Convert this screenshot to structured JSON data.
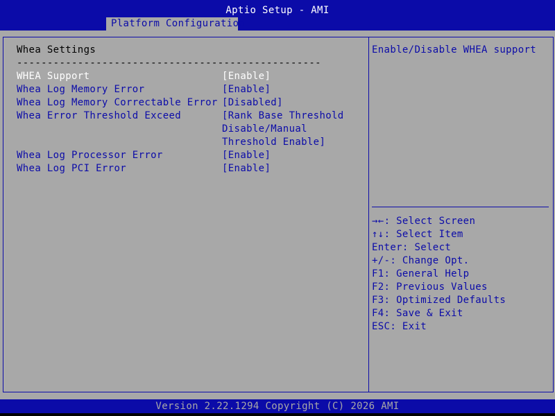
{
  "app": {
    "title": "Aptio Setup - AMI",
    "tab": "Platform Configuration"
  },
  "section": {
    "title": "Whea Settings",
    "separator": "--------------------------------------------------"
  },
  "options": [
    {
      "label": "WHEA Support",
      "value": "[Enable]",
      "selected": true
    },
    {
      "label": "Whea Log Memory Error",
      "value": "[Enable]",
      "selected": false
    },
    {
      "label": "Whea Log Memory Correctable Error",
      "value": "[Disabled]",
      "selected": false
    },
    {
      "label": "Whea Error Threshold Exceed",
      "value_lines": [
        "[Rank Base Threshold",
        "Disable/Manual",
        "Threshold Enable]"
      ],
      "selected": false
    },
    {
      "label": "Whea Log Processor Error",
      "value": "[Enable]",
      "selected": false
    },
    {
      "label": "Whea Log PCI Error",
      "value": "[Enable]",
      "selected": false
    }
  ],
  "help": {
    "description": "Enable/Disable WHEA support",
    "keys": [
      {
        "key": "→←",
        "action": ": Select Screen"
      },
      {
        "key": "↑↓",
        "action": ": Select Item"
      },
      {
        "key": "",
        "action": "Enter: Select"
      },
      {
        "key": "",
        "action": "+/-: Change Opt."
      },
      {
        "key": "",
        "action": "F1: General Help"
      },
      {
        "key": "",
        "action": "F2: Previous Values"
      },
      {
        "key": "",
        "action": "F3: Optimized Defaults"
      },
      {
        "key": "",
        "action": "F4: Save & Exit"
      },
      {
        "key": "",
        "action": "ESC: Exit"
      }
    ]
  },
  "footer": {
    "version": "Version 2.22.1294 Copyright (C) 2026 AMI"
  },
  "colors": {
    "header_bg": "#0b0ba8",
    "panel_bg": "#a8a8a8",
    "option_text": "#0b0ba8",
    "selected_text": "#ffffff"
  }
}
